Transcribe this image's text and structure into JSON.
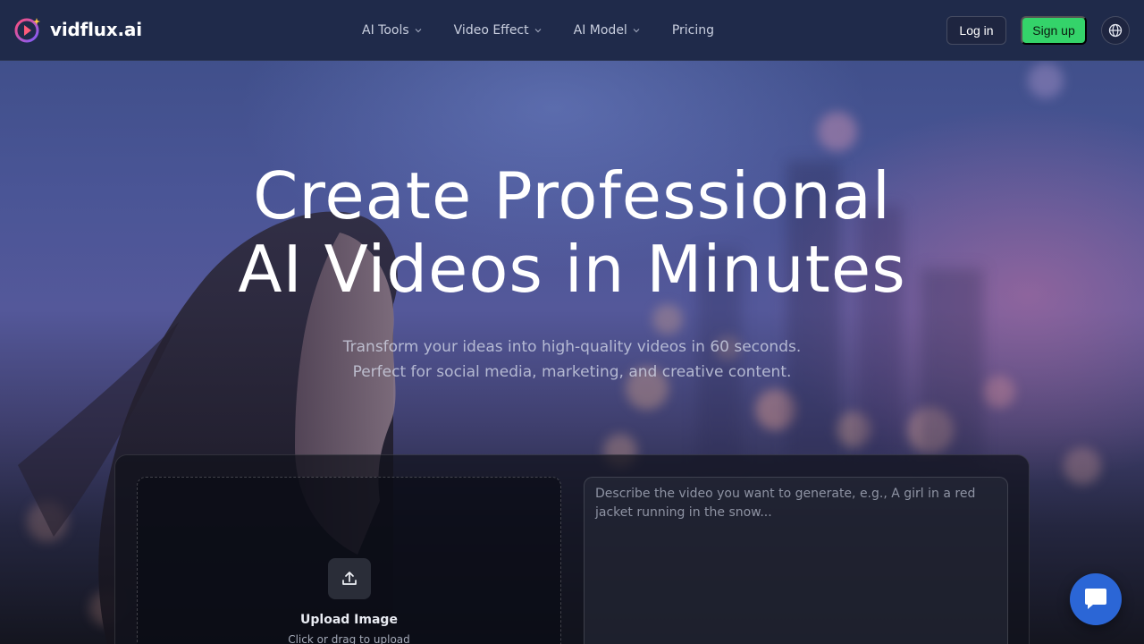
{
  "brand": {
    "name": "vidflux.ai",
    "logo_icon": "play-sparkle-logo-icon"
  },
  "nav": {
    "items": [
      {
        "label": "AI Tools",
        "has_dropdown": true
      },
      {
        "label": "Video Effect",
        "has_dropdown": true
      },
      {
        "label": "AI Model",
        "has_dropdown": true
      },
      {
        "label": "Pricing",
        "has_dropdown": false
      }
    ]
  },
  "auth": {
    "login_label": "Log in",
    "signup_label": "Sign up",
    "language_icon": "globe-icon"
  },
  "hero": {
    "title_line1": "Create Professional",
    "title_line2": "AI Videos in Minutes",
    "subtitle_line1": "Transform your ideas into high-quality videos in 60 seconds.",
    "subtitle_line2": "Perfect for social media, marketing, and creative content."
  },
  "generator": {
    "upload_title": "Upload Image",
    "upload_hint": "Click or drag to upload",
    "upload_icon": "upload-icon",
    "prompt_placeholder": "Describe the video you want to generate, e.g., A girl in a red jacket running in the snow..."
  },
  "chat": {
    "icon": "chat-icon"
  },
  "colors": {
    "header_bg": "#1f2a4a",
    "signup_bg": "#34d36a",
    "chat_bg": "#2b66d6",
    "logo_gradient_start": "#ff4f7a",
    "logo_gradient_end": "#7b5cff"
  }
}
